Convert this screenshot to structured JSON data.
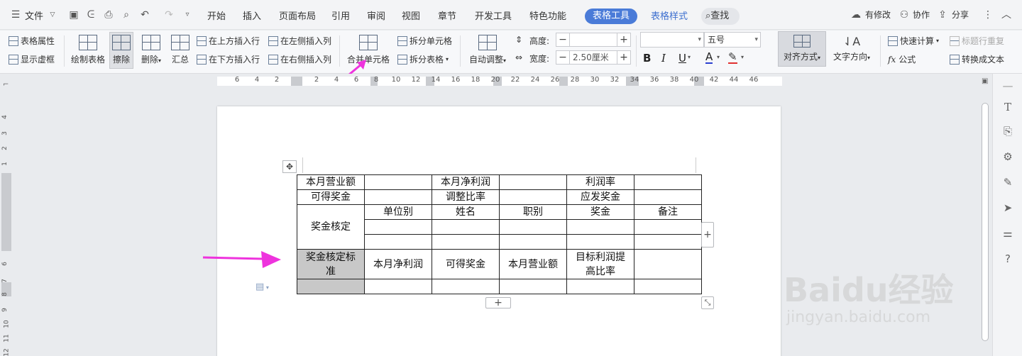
{
  "menu": {
    "file": "文件",
    "tabs": [
      "开始",
      "插入",
      "页面布局",
      "引用",
      "审阅",
      "视图",
      "章节",
      "开发工具",
      "特色功能"
    ],
    "active_tab": "表格工具",
    "tab_table_style": "表格样式",
    "search": "查找",
    "modified": "有修改",
    "collab": "协作",
    "share": "分享"
  },
  "ribbon": {
    "table_props": "表格属性",
    "show_grid": "显示虚框",
    "draw_table": "绘制表格",
    "erase": "擦除",
    "delete": "删除",
    "summary": "汇总",
    "insert_above": "在上方插入行",
    "insert_below": "在下方插入行",
    "insert_left": "在左侧插入列",
    "insert_right": "在右侧插入列",
    "merge_cells": "合并单元格",
    "split_cells": "拆分单元格",
    "split_table": "拆分表格",
    "auto_adjust": "自动调整",
    "height_label": "高度:",
    "height_value": "",
    "width_label": "宽度:",
    "width_value": "2.50厘米",
    "font_name": "",
    "font_size": "五号",
    "bold": "B",
    "italic": "I",
    "underline": "U",
    "font_color": "A",
    "align": "对齐方式",
    "text_dir": "文字方向",
    "quick_calc": "快速计算",
    "formula": "公式",
    "repeat_title": "标题行重复",
    "to_text": "转换成文本"
  },
  "ruler_top": [
    "6",
    "4",
    "2",
    "2",
    "4",
    "6",
    "8",
    "10",
    "12",
    "14",
    "16",
    "18",
    "20",
    "22",
    "24",
    "26",
    "28",
    "30",
    "32",
    "34",
    "36",
    "38",
    "40",
    "42",
    "44",
    "46"
  ],
  "ruler_left": [
    "4",
    "3",
    "2",
    "1",
    "6",
    "7",
    "8",
    "9",
    "10",
    "11",
    "12"
  ],
  "table": {
    "r1": [
      "本月营业额",
      "",
      "本月净利润",
      "",
      "利润率",
      ""
    ],
    "r2": [
      "可得奖金",
      "",
      "调整比率",
      "",
      "应发奖金",
      ""
    ],
    "award": "奖金核定",
    "r3": [
      "单位别",
      "姓名",
      "职别",
      "奖金",
      "备注"
    ],
    "std": "奖金核定标准",
    "r6": [
      "本月净利润",
      "可得奖金",
      "本月营业额",
      "目标利润提高比率",
      ""
    ]
  },
  "watermark": {
    "brand": "Baidu经验",
    "url": "jingyan.baidu.com"
  },
  "colors": {
    "accent": "#4a7bd8",
    "arrow": "#ee33dd",
    "cell_selected": "#c8c8c8"
  }
}
